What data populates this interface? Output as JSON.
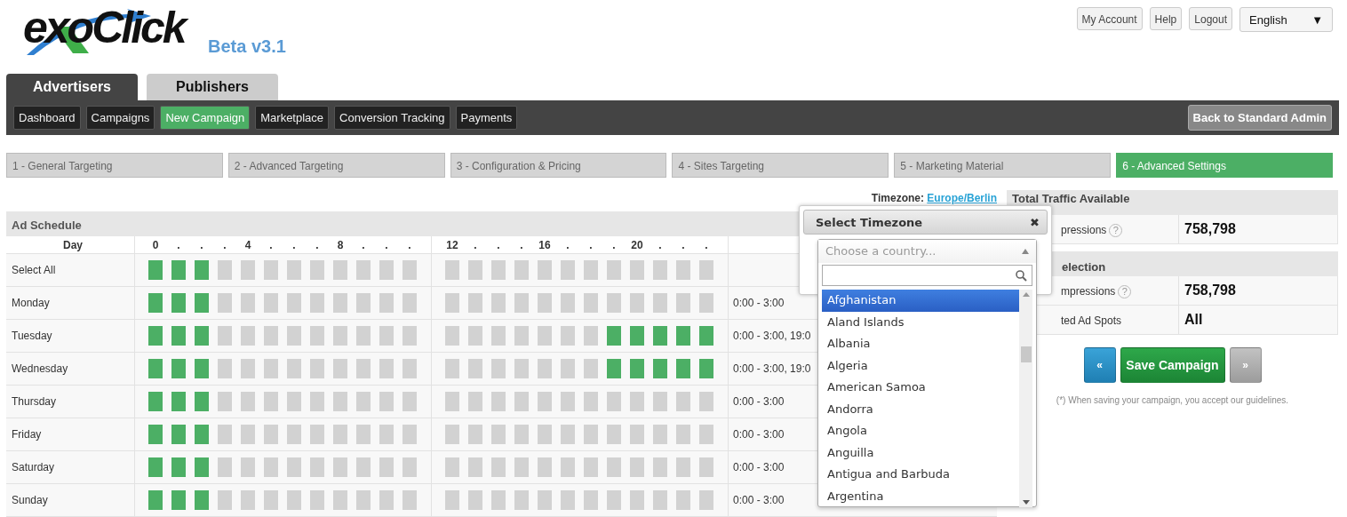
{
  "logo": {
    "text": "exoClick",
    "version": "Beta v3.1"
  },
  "account_links": [
    "My Account",
    "Help",
    "Logout"
  ],
  "language": {
    "value": "English",
    "caret": "▼"
  },
  "main_tabs": [
    {
      "label": "Advertisers",
      "selected": true
    },
    {
      "label": "Publishers",
      "selected": false
    }
  ],
  "menu": [
    {
      "label": "Dashboard",
      "selected": false
    },
    {
      "label": "Campaigns",
      "selected": false
    },
    {
      "label": "New Campaign",
      "selected": true
    },
    {
      "label": "Marketplace",
      "selected": false
    },
    {
      "label": "Conversion Tracking",
      "selected": false
    },
    {
      "label": "Payments",
      "selected": false
    }
  ],
  "admin_button": "Back to Standard Admin",
  "steps": [
    {
      "label": "1 - General Targeting",
      "selected": false
    },
    {
      "label": "2 - Advanced Targeting",
      "selected": false
    },
    {
      "label": "3 - Configuration & Pricing",
      "selected": false
    },
    {
      "label": "4 - Sites Targeting",
      "selected": false
    },
    {
      "label": "5 - Marketing Material",
      "selected": false
    },
    {
      "label": "6 - Advanced Settings",
      "selected": true
    }
  ],
  "timezone": {
    "label": "Timezone:",
    "value": "Europe/Berlin"
  },
  "schedule": {
    "title": "Ad Schedule",
    "day_header": "Day",
    "hour_labels": [
      "0",
      ".",
      ".",
      ".",
      "4",
      ".",
      ".",
      ".",
      "8",
      ".",
      ".",
      ".",
      "12",
      ".",
      ".",
      ".",
      "16",
      ".",
      ".",
      ".",
      "20",
      ".",
      ".",
      "."
    ],
    "rows": [
      {
        "day": "Select All",
        "slots": [
          true,
          true,
          true,
          false,
          false,
          false,
          false,
          false,
          false,
          false,
          false,
          false,
          false,
          false,
          false,
          false,
          false,
          false,
          false,
          false,
          false,
          false,
          false,
          false
        ]
      },
      {
        "day": "Monday",
        "summary": "0:00 - 3:00",
        "slots": [
          true,
          true,
          true,
          false,
          false,
          false,
          false,
          false,
          false,
          false,
          false,
          false,
          false,
          false,
          false,
          false,
          false,
          false,
          false,
          false,
          false,
          false,
          false,
          false
        ]
      },
      {
        "day": "Tuesday",
        "summary": "0:00 - 3:00, 19:0",
        "slots": [
          true,
          true,
          true,
          false,
          false,
          false,
          false,
          false,
          false,
          false,
          false,
          false,
          false,
          false,
          false,
          false,
          false,
          false,
          false,
          true,
          true,
          true,
          true,
          true
        ]
      },
      {
        "day": "Wednesday",
        "summary": "0:00 - 3:00, 19:0",
        "slots": [
          true,
          true,
          true,
          false,
          false,
          false,
          false,
          false,
          false,
          false,
          false,
          false,
          false,
          false,
          false,
          false,
          false,
          false,
          false,
          true,
          true,
          true,
          true,
          true
        ]
      },
      {
        "day": "Thursday",
        "summary": "0:00 - 3:00",
        "slots": [
          true,
          true,
          true,
          false,
          false,
          false,
          false,
          false,
          false,
          false,
          false,
          false,
          false,
          false,
          false,
          false,
          false,
          false,
          false,
          false,
          false,
          false,
          false,
          false
        ]
      },
      {
        "day": "Friday",
        "summary": "0:00 - 3:00",
        "slots": [
          true,
          true,
          true,
          false,
          false,
          false,
          false,
          false,
          false,
          false,
          false,
          false,
          false,
          false,
          false,
          false,
          false,
          false,
          false,
          false,
          false,
          false,
          false,
          false
        ]
      },
      {
        "day": "Saturday",
        "summary": "0:00 - 3:00",
        "slots": [
          true,
          true,
          true,
          false,
          false,
          false,
          false,
          false,
          false,
          false,
          false,
          false,
          false,
          false,
          false,
          false,
          false,
          false,
          false,
          false,
          false,
          false,
          false,
          false
        ]
      },
      {
        "day": "Sunday",
        "summary": "0:00 - 3:00",
        "slots": [
          true,
          true,
          true,
          false,
          false,
          false,
          false,
          false,
          false,
          false,
          false,
          false,
          false,
          false,
          false,
          false,
          false,
          false,
          false,
          false,
          false,
          false,
          false,
          false
        ]
      }
    ]
  },
  "traffic_panels": [
    {
      "title": "Total Traffic Available",
      "rows": [
        {
          "label": "pressions",
          "help": "?",
          "value": "758,798"
        }
      ]
    },
    {
      "title": "election",
      "rows": [
        {
          "label": "mpressions",
          "help": "?",
          "value": "758,798"
        },
        {
          "label": "ted Ad Spots",
          "value": "All"
        }
      ]
    }
  ],
  "nav_buttons": {
    "previous": "«",
    "save": "Save Campaign",
    "next": "»"
  },
  "note": {
    "text": "(*) When saving your campaign, you accept our",
    "link": "guidelines",
    "end": "."
  },
  "timezone_dialog": {
    "title": "Select Timezone",
    "close": "✖",
    "placeholder": "Choose a country...",
    "countries": [
      {
        "name": "Afghanistan",
        "selected": true
      },
      {
        "name": "Aland Islands",
        "selected": false
      },
      {
        "name": "Albania",
        "selected": false
      },
      {
        "name": "Algeria",
        "selected": false
      },
      {
        "name": "American Samoa",
        "selected": false
      },
      {
        "name": "Andorra",
        "selected": false
      },
      {
        "name": "Angola",
        "selected": false
      },
      {
        "name": "Anguilla",
        "selected": false
      },
      {
        "name": "Antigua and Barbuda",
        "selected": false
      },
      {
        "name": "Argentina",
        "selected": false
      }
    ]
  }
}
